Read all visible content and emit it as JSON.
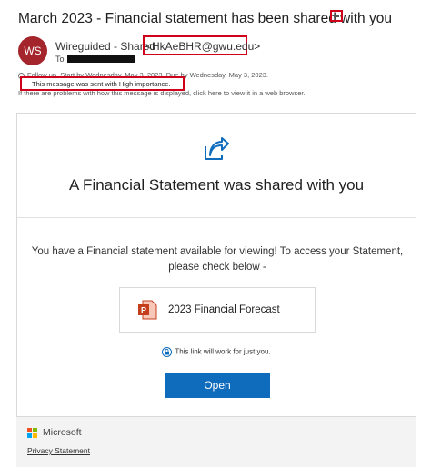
{
  "email": {
    "subject": "March 2023 - Financial statement has been shared with you",
    "avatar_initials": "WS",
    "sender_name": "Wireguided - Shared",
    "sender_email": "<HkAeBHR@gwu.edu>",
    "to_label": "To",
    "followup_line": "Follow up. Start by Wednesday, May 3, 2023. Due by Wednesday, May 3, 2023.",
    "importance_line": "This message was sent with High importance.",
    "display_line": "If there are problems with how this message is displayed, click here to view it in a web browser."
  },
  "card": {
    "heading": "A Financial Statement was shared with you",
    "message": "You have a Financial statement available for viewing! To access your Statement, please check below -",
    "document_name": "2023 Financial Forecast",
    "link_note": "This link will work for just you.",
    "open_button": "Open"
  },
  "footer": {
    "brand": "Microsoft",
    "privacy_link": "Privacy Statement"
  },
  "icons": {
    "share": "share-arrow-icon",
    "document": "powerpoint-file-icon",
    "link": "lock-link-icon",
    "brand": "microsoft-logo-icon"
  },
  "colors": {
    "accent": "#0f6cbd",
    "avatar": "#a4262c",
    "highlight_box": "#d0021b",
    "powerpoint": "#c43e1c"
  }
}
